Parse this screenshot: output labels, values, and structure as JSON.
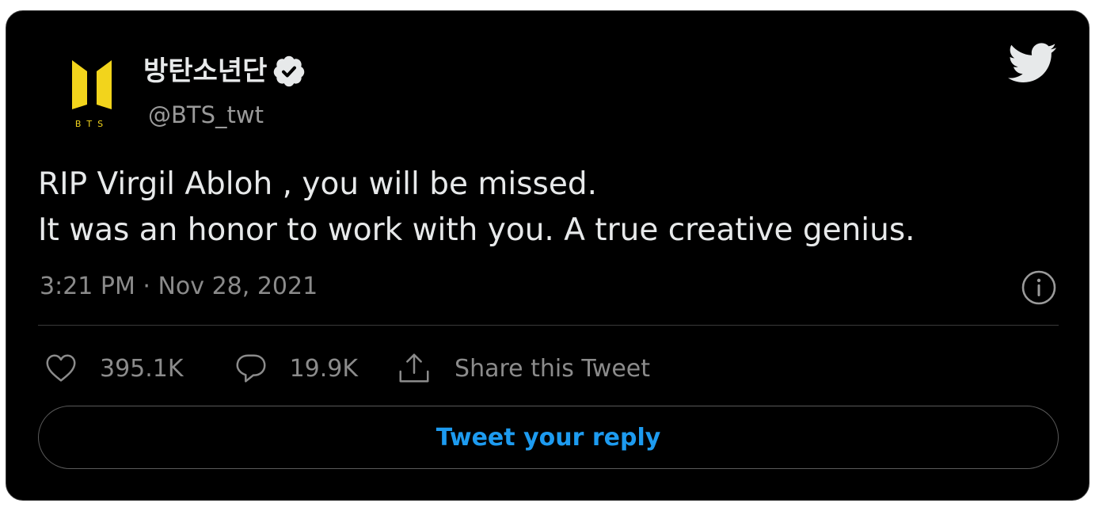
{
  "tweet": {
    "display_name": "방탄소년단",
    "handle": "@BTS_twt",
    "verified": true,
    "avatar_logo_text": "BTS",
    "text_lines": [
      "RIP Virgil Abloh , you will be missed.",
      "It was an honor to work with you. A true creative genius."
    ],
    "timestamp": "3:21 PM · Nov 28, 2021"
  },
  "actions": {
    "likes": "395.1K",
    "replies": "19.9K",
    "share_label": "Share this Tweet"
  },
  "reply_button_label": "Tweet your reply",
  "colors": {
    "background": "#000000",
    "text": "#e7e9ea",
    "secondary_text": "#8b8b8b",
    "accent": "#1d9bf0",
    "avatar_yellow": "#f2d41c"
  },
  "icons": {
    "brand": "twitter-bird-icon",
    "verified": "verified-badge-icon",
    "info": "info-icon",
    "like": "heart-icon",
    "reply": "comment-bubble-icon",
    "share": "share-upload-icon"
  }
}
